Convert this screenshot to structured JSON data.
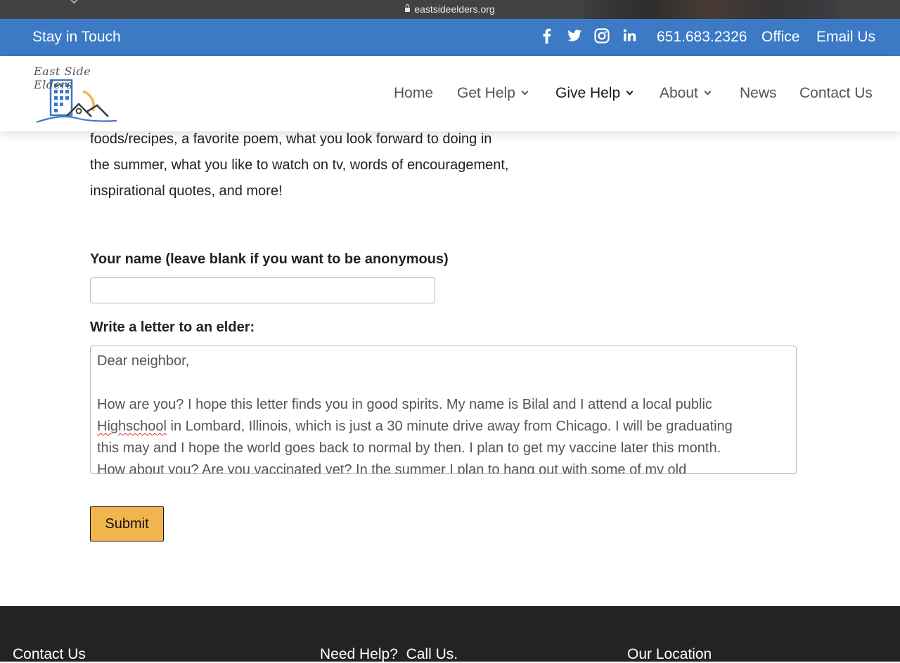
{
  "browser": {
    "url": "eastsideelders.org"
  },
  "topbar": {
    "stay": "Stay in Touch",
    "phone": "651.683.2326",
    "office": "Office",
    "email": "Email Us",
    "social": [
      "facebook-icon",
      "twitter-icon",
      "instagram-icon",
      "linkedin-icon"
    ]
  },
  "header": {
    "logo_text": "East Side Elders",
    "nav": [
      {
        "label": "Home"
      },
      {
        "label": "Get Help"
      },
      {
        "label": "Give Help"
      },
      {
        "label": "About"
      },
      {
        "label": "News"
      },
      {
        "label": "Contact Us"
      }
    ]
  },
  "content": {
    "intro_lines": [
      "foods/recipes, a favorite poem, what you look forward to doing in",
      "the summer, what you like to watch on tv, words of encouragement,",
      "inspirational quotes, and more!"
    ],
    "name_label": "Your name (leave blank if you want to be anonymous)",
    "name_value": "",
    "letter_label": "Write a letter to an elder:",
    "letter": {
      "greeting": "Dear neighbor,",
      "line1": "How are you? I hope this letter finds you in good spirits. My name is Bilal and I attend a local public",
      "misspelled": "Highschool",
      "line2_rest": " in Lombard, Illinois, which is just a 30 minute drive away from Chicago. I will be graduating",
      "line3": "this may and I hope the world goes back to normal by then. I plan to get my vaccine later this month.",
      "line4": "How about you? Are you vaccinated yet? In the summer I plan to hang out with some of my old"
    },
    "submit": "Submit"
  },
  "footer": {
    "col1": "Contact Us",
    "col2": "Need Help?  Call Us.",
    "col3": "Our Location"
  },
  "colors": {
    "topbar": "#3c7ac6",
    "submit": "#f1b54e",
    "footer": "#232323"
  }
}
